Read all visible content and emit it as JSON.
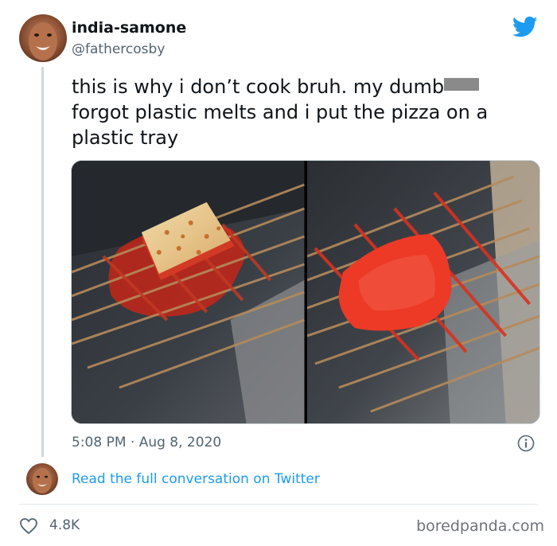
{
  "author": {
    "display_name": "india-samone",
    "handle": "@fathercosby"
  },
  "tweet": {
    "line1": "this is why i don’t cook bruh. my dumb",
    "line2": "forgot plastic melts and i put the pizza on a",
    "line3": "plastic tray"
  },
  "meta": {
    "timestamp": "5:08 PM · Aug 8, 2020"
  },
  "conversation": {
    "link_label": "Read the full conversation on Twitter"
  },
  "engagement": {
    "likes": "4.8K"
  },
  "watermark": "boredpanda.com",
  "colors": {
    "accent": "#1d9bf0",
    "muted_text": "#536471",
    "melted_plastic": "#e8321f"
  },
  "icons": [
    "twitter-bird-icon",
    "info-icon",
    "heart-icon"
  ]
}
